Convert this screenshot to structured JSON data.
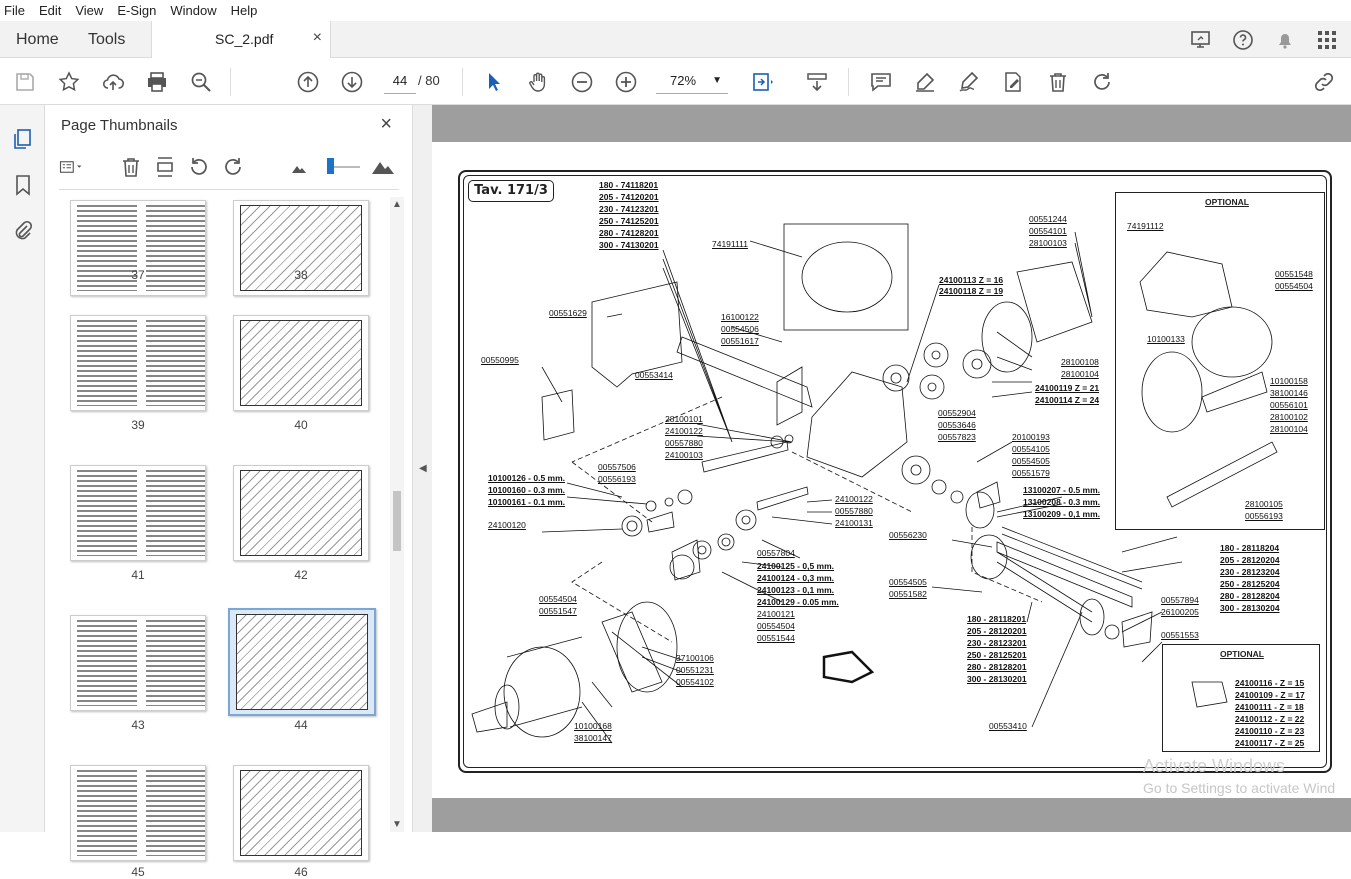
{
  "menu": [
    "File",
    "Edit",
    "View",
    "E-Sign",
    "Window",
    "Help"
  ],
  "tabs": {
    "home": "Home",
    "tools": "Tools",
    "document": "SC_2.pdf",
    "close": "×"
  },
  "toolbar": {
    "page_current": "44",
    "page_total": "/ 80",
    "zoom": "72%"
  },
  "panel": {
    "title": "Page Thumbnails",
    "close": "×"
  },
  "thumbnails": [
    {
      "label": "37"
    },
    {
      "label": "38"
    },
    {
      "label": "39"
    },
    {
      "label": "40"
    },
    {
      "label": "41"
    },
    {
      "label": "42"
    },
    {
      "label": "43"
    },
    {
      "label": "44",
      "selected": true
    },
    {
      "label": "45"
    },
    {
      "label": "46"
    }
  ],
  "drawing": {
    "title": "Tav. 171/3",
    "optional_top": "OPTIONAL",
    "optional_bottom": "OPTIONAL",
    "labels": {
      "l180a": "180 - 74118201",
      "l205a": "205 - 74120201",
      "l230a": "230 - 74123201",
      "l250a": "250 - 74125201",
      "l280a": "280 - 74128201",
      "l300a": "300 - 74130201",
      "p74191111": "74191111",
      "p00551629": "00551629",
      "p16100122": "16100122",
      "p00554506": "00554506",
      "p00551617": "00551617",
      "p00550995": "00550995",
      "p00553414": "00553414",
      "p00551244": "00551244",
      "p00554101": "00554101",
      "p28100103": "28100103",
      "z16": "24100113 Z = 16",
      "z19": "24100118 Z = 19",
      "p28100108": "28100108",
      "p28100104": "28100104",
      "z21": "24100119 Z = 21",
      "z24": "24100114 Z = 24",
      "p28100101": "28100101",
      "p24100122a": "24100122",
      "p00557880a": "00557880",
      "p24100103": "24100103",
      "p00552904": "00552904",
      "p00553646": "00553646",
      "p00557823": "00557823",
      "p20100193": "20100193",
      "p00554105": "00554105",
      "p00554505a": "00554505",
      "p00551579": "00551579",
      "p00557506": "00557506",
      "p00556193a": "00556193",
      "s05": "10100126 - 0.5 mm.",
      "s03": "10100160 - 0.3 mm.",
      "s01": "10100161 - 0.1 mm.",
      "p24100120": "24100120",
      "p24100122b": "24100122",
      "p00557880b": "00557880",
      "p24100131": "24100131",
      "t05": "13100207 - 0.5 mm.",
      "t03": "13100208 - 0.3 mm.",
      "t01": "13100209 - 0,1 mm.",
      "p00556230": "00556230",
      "p00557804": "00557804",
      "u05": "24100125 - 0,5 mm.",
      "u03": "24100124 - 0,3 mm.",
      "u01": "24100123 - 0,1 mm.",
      "u005": "24100129 - 0.05 mm.",
      "p24100121": "24100121",
      "p00554504a": "00554504",
      "p00551544": "00551544",
      "p00554504b": "00554504",
      "p00551547": "00551547",
      "p00554505b": "00554505",
      "p00551582": "00551582",
      "b180": "180 - 28118204",
      "b205": "205 - 28120204",
      "b230": "230 - 28123204",
      "b250": "250 - 28125204",
      "b280": "280 - 28128204",
      "b300": "300 - 28130204",
      "p37100106": "37100106",
      "p00551231": "00551231",
      "p00554102": "00554102",
      "c180": "180 - 28118201",
      "c205": "205 - 28120201",
      "c230": "230 - 28123201",
      "c250": "250 - 28125201",
      "c280": "280 - 28128201",
      "c300": "300 - 28130201",
      "p00557894": "00557894",
      "p26100205": "26100205",
      "p00551553": "00551553",
      "p10100168": "10100168",
      "p38100147": "38100147",
      "p00553410": "00553410",
      "o74191112": "74191112",
      "o00551548": "00551548",
      "o00554504": "00554504",
      "o10100133": "10100133",
      "o10100158": "10100158",
      "o38100146": "38100146",
      "o00556101": "00556101",
      "o28100102": "28100102",
      "o28100104": "28100104",
      "o28100105": "28100105",
      "o00556193": "00556193",
      "g15": "24100116 - Z = 15",
      "g17": "24100109 - Z = 17",
      "g18": "24100111 - Z = 18",
      "g22": "24100112 - Z = 22",
      "g23": "24100110 - Z = 23",
      "g25": "24100117 - Z = 25"
    }
  },
  "watermark": {
    "line1": "Activate Windows",
    "line2": "Go to Settings to activate Wind"
  }
}
